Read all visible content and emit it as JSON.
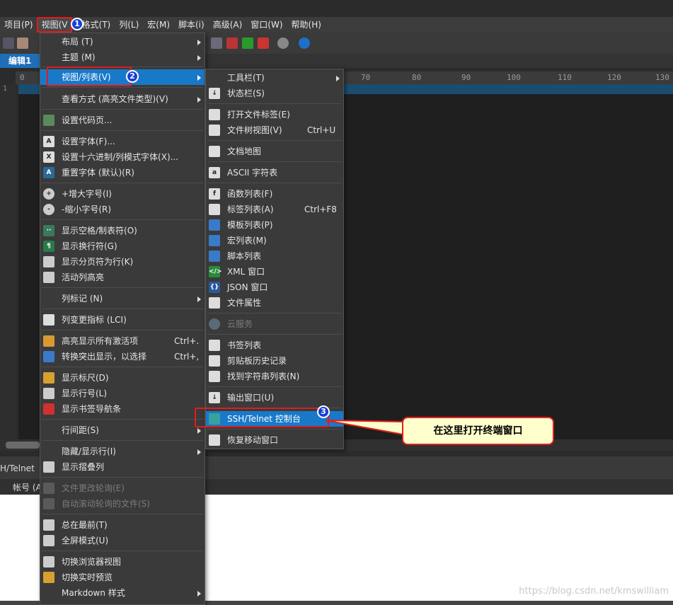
{
  "menubar": {
    "items": [
      "项目(P)",
      "视图(V",
      "格式(T)",
      "列(L)",
      "宏(M)",
      "脚本(i)",
      "高级(A)",
      "窗口(W)",
      "帮助(H)"
    ]
  },
  "tabs": {
    "active": "编辑1"
  },
  "ruler": {
    "ticks": [
      "0",
      "70",
      "80",
      "90",
      "100",
      "110",
      "120",
      "130"
    ]
  },
  "gutter": {
    "line1": "1"
  },
  "view_menu": {
    "items": [
      {
        "label": "布局 (T)"
      },
      {
        "label": "主题 (M)"
      },
      {
        "label": "视图/列表(V)"
      },
      {
        "label": "查看方式 (高亮文件类型)(V)"
      },
      {
        "label": "设置代码页..."
      },
      {
        "label": "设置字体(F)..."
      },
      {
        "label": "设置十六进制/列模式字体(X)..."
      },
      {
        "label": "重置字体 (默认)(R)"
      },
      {
        "label": "+增大字号(I)"
      },
      {
        "label": "-缩小字号(R)"
      },
      {
        "label": "显示空格/制表符(O)"
      },
      {
        "label": "显示换行符(G)"
      },
      {
        "label": "显示分页符为行(K)"
      },
      {
        "label": "活动列高亮"
      },
      {
        "label": "列标记 (N)"
      },
      {
        "label": "列变更指标 (LCI)"
      },
      {
        "label": "高亮显示所有激活项",
        "shortcut": "Ctrl+."
      },
      {
        "label": "转换突出显示，以选择",
        "shortcut": "Ctrl+,"
      },
      {
        "label": "显示标尺(D)"
      },
      {
        "label": "显示行号(L)"
      },
      {
        "label": "显示书签导航条"
      },
      {
        "label": "行间距(S)"
      },
      {
        "label": "隐藏/显示行(I)"
      },
      {
        "label": "显示摺叠列"
      },
      {
        "label": "文件更改轮询(E)"
      },
      {
        "label": "自动滚动轮询的文件(S)"
      },
      {
        "label": "总在最前(T)"
      },
      {
        "label": "全屏模式(U)"
      },
      {
        "label": "切换浏览器视图"
      },
      {
        "label": "切换实时预览"
      },
      {
        "label": "Markdown 样式"
      }
    ]
  },
  "sub_menu": {
    "items": [
      {
        "label": "工具栏(T)"
      },
      {
        "label": "状态栏(S)"
      },
      {
        "label": "打开文件标签(E)"
      },
      {
        "label": "文件树视图(V)",
        "shortcut": "Ctrl+U"
      },
      {
        "label": "文档地图"
      },
      {
        "label": "ASCII 字符表"
      },
      {
        "label": "函数列表(F)"
      },
      {
        "label": "标签列表(A)",
        "shortcut": "Ctrl+F8"
      },
      {
        "label": "模板列表(P)"
      },
      {
        "label": "宏列表(M)"
      },
      {
        "label": "脚本列表"
      },
      {
        "label": "XML 窗口"
      },
      {
        "label": "JSON 窗口"
      },
      {
        "label": "文件属性"
      },
      {
        "label": "云服务"
      },
      {
        "label": "书签列表"
      },
      {
        "label": "剪贴板历史记录"
      },
      {
        "label": "找到字符串列表(N)"
      },
      {
        "label": "输出窗口(U)"
      },
      {
        "label": "SSH/Telnet 控制台"
      },
      {
        "label": "恢复移动窗口"
      }
    ]
  },
  "bottom": {
    "panel_tab": "H/Telnet",
    "account_label": "帐号 (A"
  },
  "annotations": {
    "badge1": "1",
    "badge2": "2",
    "badge3": "3",
    "callout": "在这里打开终端窗口",
    "watermark": "https://blog.csdn.net/kmswilliam"
  },
  "colors": {
    "highlight": "#1979c9",
    "annotation_red": "#e21b1b",
    "badge_blue": "#1a3fd6",
    "callout_bg": "#ffffcc"
  }
}
